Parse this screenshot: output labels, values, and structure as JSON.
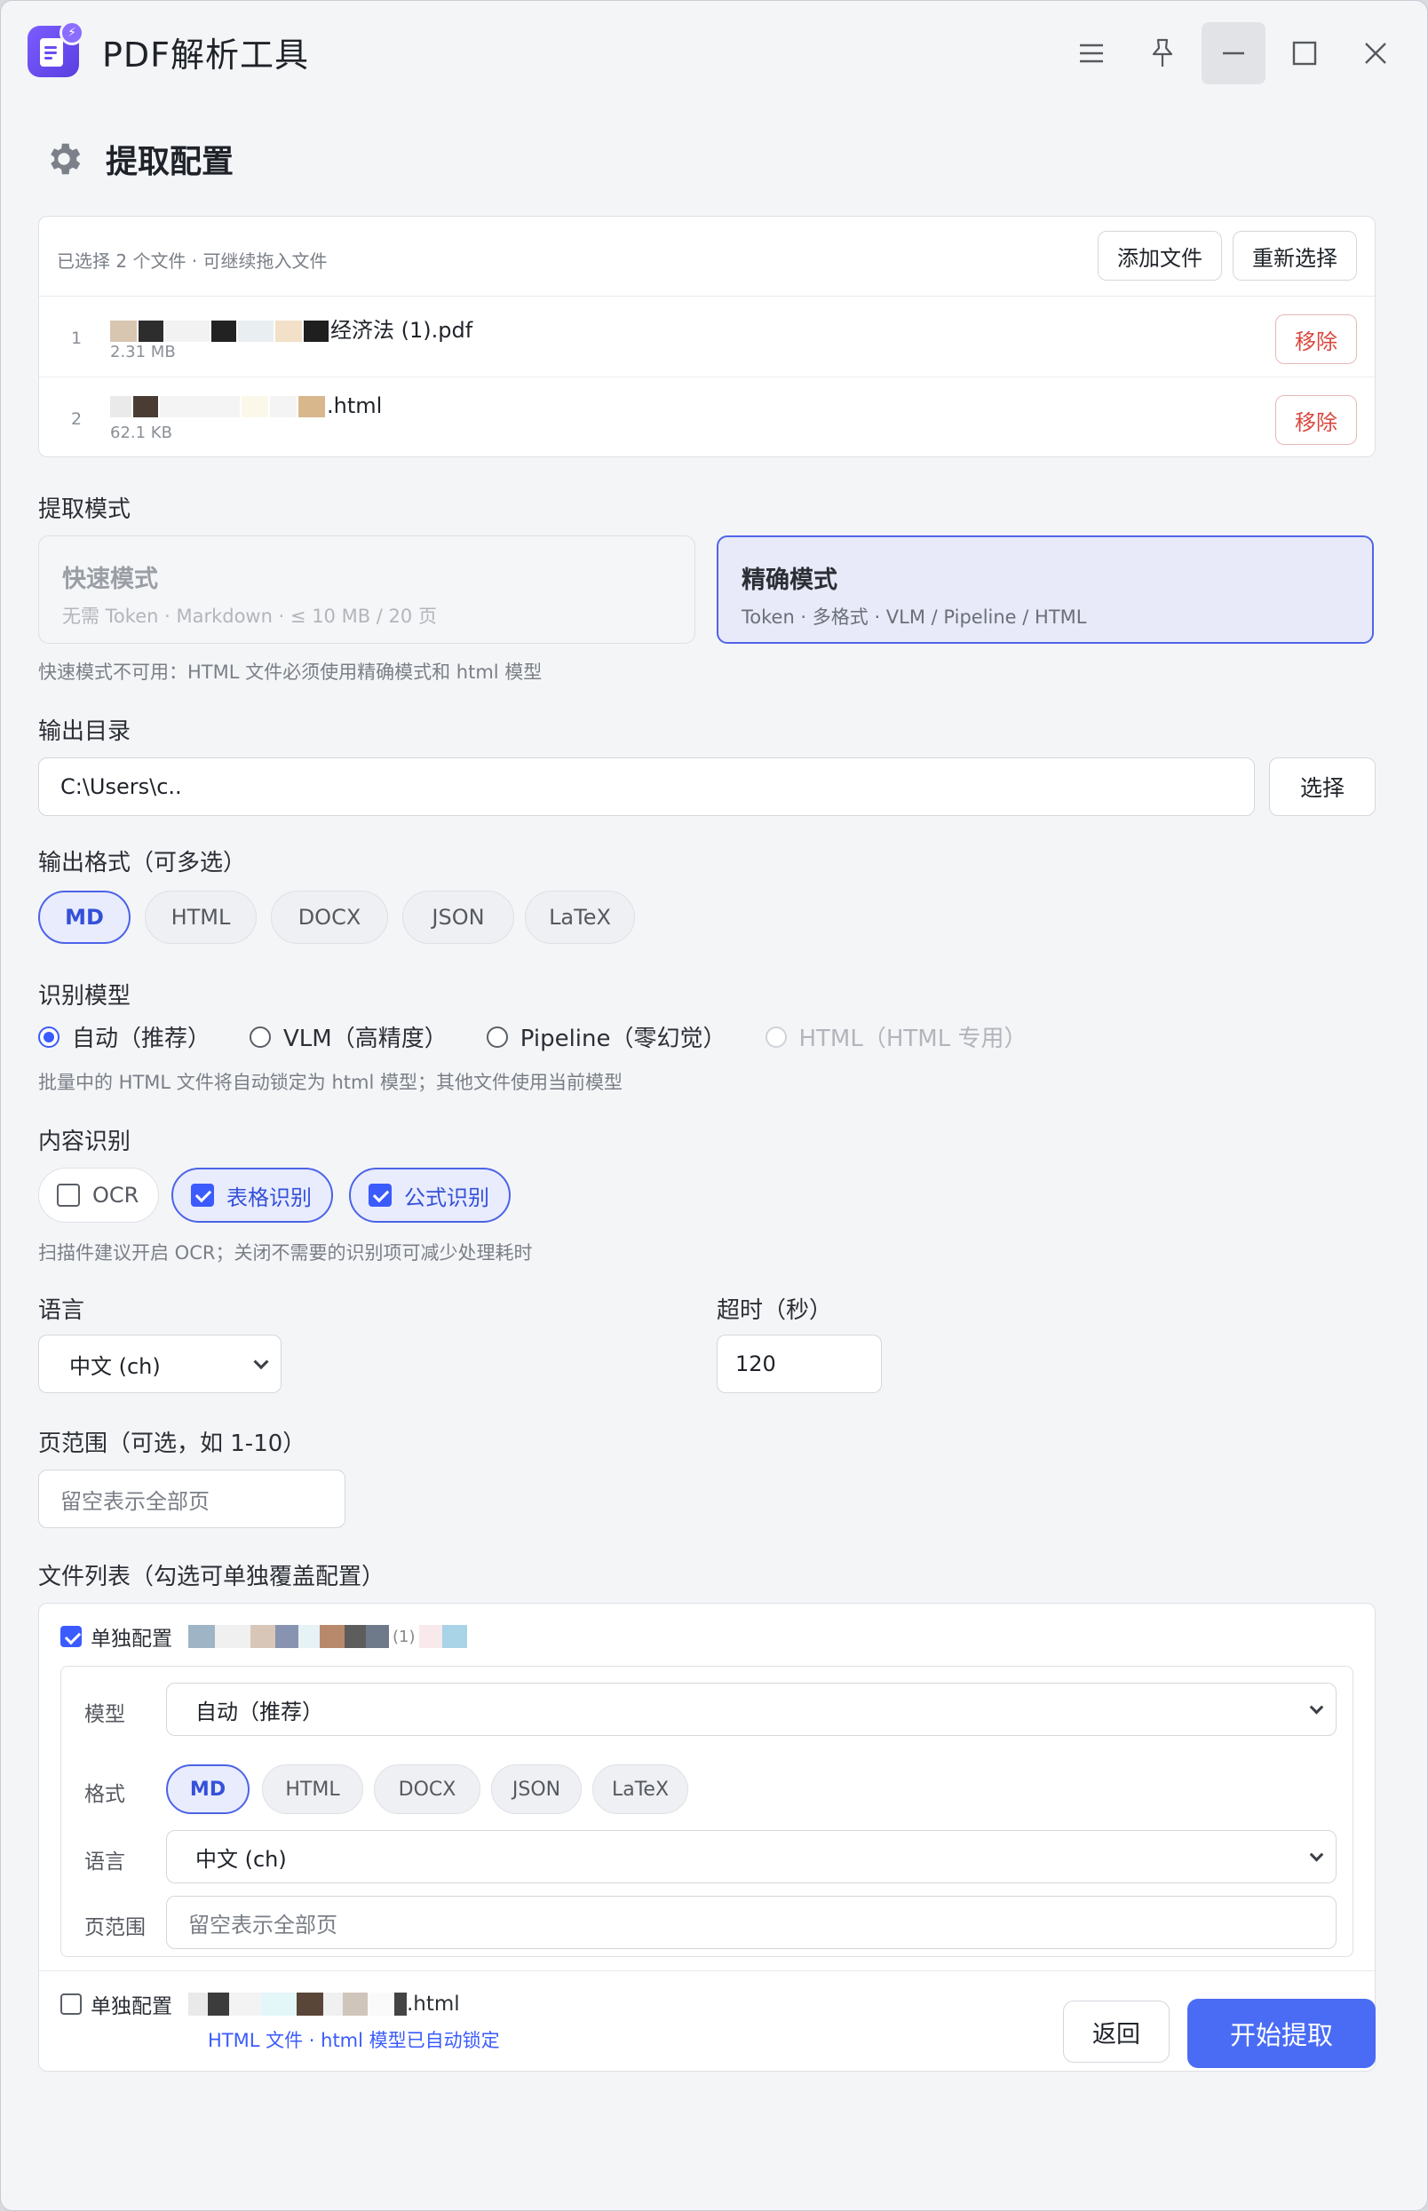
{
  "app": {
    "title": "PDF解析工具"
  },
  "window_controls": [
    "menu-icon",
    "pin-icon",
    "minimize-icon",
    "maximize-icon",
    "close-icon"
  ],
  "header": {
    "title": "提取配置",
    "icon": "gear-icon"
  },
  "files": {
    "hint": "已选择 2 个文件 · 可继续拖入文件",
    "add_label": "添加文件",
    "reselect_label": "重新选择",
    "remove_label": "移除",
    "items": [
      {
        "index": "1",
        "name_visible": "经济法 (1).pdf",
        "size": "2.31 MB"
      },
      {
        "index": "2",
        "name_visible": ".html",
        "size": "62.1 KB"
      }
    ]
  },
  "mode": {
    "label": "提取模式",
    "fast": {
      "title": "快速模式",
      "desc": "无需 Token · Markdown · ≤ 10 MB / 20 页",
      "state": "disabled"
    },
    "precise": {
      "title": "精确模式",
      "desc": "Token · 多格式 · VLM / Pipeline / HTML",
      "state": "selected"
    },
    "hint": "快速模式不可用：HTML 文件必须使用精确模式和 html 模型"
  },
  "output_dir": {
    "label": "输出目录",
    "value": "C:\\Users\\c..",
    "choose_label": "选择"
  },
  "formats": {
    "label": "输出格式（可多选）",
    "options": [
      "MD",
      "HTML",
      "DOCX",
      "JSON",
      "LaTeX"
    ],
    "selected": [
      "MD"
    ]
  },
  "model": {
    "label": "识别模型",
    "options": [
      "自动（推荐）",
      "VLM（高精度）",
      "Pipeline（零幻觉）",
      "HTML（HTML 专用）"
    ],
    "selected": "自动（推荐）",
    "disabled": [
      "HTML（HTML 专用）"
    ],
    "hint": "批量中的 HTML 文件将自动锁定为 html 模型；其他文件使用当前模型"
  },
  "content": {
    "label": "内容识别",
    "options": [
      {
        "label": "OCR",
        "checked": false
      },
      {
        "label": "表格识别",
        "checked": true
      },
      {
        "label": "公式识别",
        "checked": true
      }
    ],
    "hint": "扫描件建议开启 OCR；关闭不需要的识别项可减少处理耗时"
  },
  "language": {
    "label": "语言",
    "value": "中文 (ch)"
  },
  "timeout": {
    "label": "超时（秒）",
    "value": "120"
  },
  "page_range": {
    "label": "页范围（可选，如 1-10）",
    "placeholder": "留空表示全部页"
  },
  "file_list": {
    "label": "文件列表（勾选可单独覆盖配置）",
    "override_label": "单独配置",
    "items": [
      {
        "checked": true,
        "name_visible": "(1)",
        "settings": {
          "model_label": "模型",
          "model_value": "自动（推荐）",
          "format_label": "格式",
          "formats": [
            "MD",
            "HTML",
            "DOCX",
            "JSON",
            "LaTeX"
          ],
          "selected_format": "MD",
          "lang_label": "语言",
          "lang_value": "中文 (ch)",
          "range_label": "页范围",
          "range_placeholder": "留空表示全部页"
        }
      },
      {
        "checked": false,
        "name_visible": ".html",
        "lock_hint": "HTML 文件 · html 模型已自动锁定"
      }
    ]
  },
  "actions": {
    "back_label": "返回",
    "start_label": "开始提取"
  },
  "colors": {
    "accent": "#4a6cf5",
    "danger": "#d9483e",
    "logo": "#6a4cf0"
  }
}
